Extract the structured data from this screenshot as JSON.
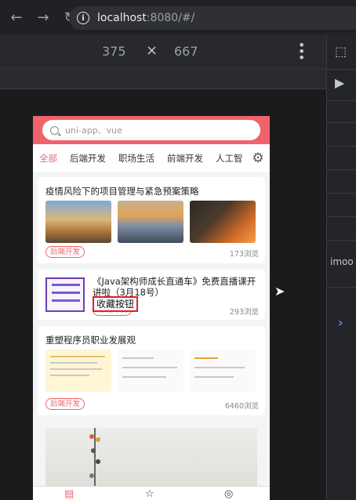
{
  "browser": {
    "url_host": "localhost",
    "url_rest": ":8080/#/",
    "back_icon": "back-arrow-icon",
    "forward_icon": "forward-arrow-icon",
    "reload_icon": "reload-icon"
  },
  "device_toolbar": {
    "width": "375",
    "separator": "×",
    "height": "667"
  },
  "devtools": {
    "side_text": "imoo"
  },
  "app": {
    "search_placeholder": "uni-app、vue",
    "tabs": [
      "全部",
      "后端开发",
      "职场生活",
      "前端开发",
      "人工智"
    ],
    "cards": [
      {
        "title": "疫情风险下的项目管理与紧急预案策略",
        "tag": "后端开发",
        "views": "173浏览"
      },
      {
        "title": "《Java架构师成长直通车》免费直播课开讲啦（3月18号）",
        "tag": "后端开发",
        "views": "293浏览",
        "overlay_button": "收藏按钮"
      },
      {
        "title": "重塑程序员职业发展观",
        "tag": "后端开发",
        "views": "6460浏览"
      }
    ]
  },
  "colors": {
    "accent": "#f0636a",
    "highlight_border": "#e02020"
  }
}
